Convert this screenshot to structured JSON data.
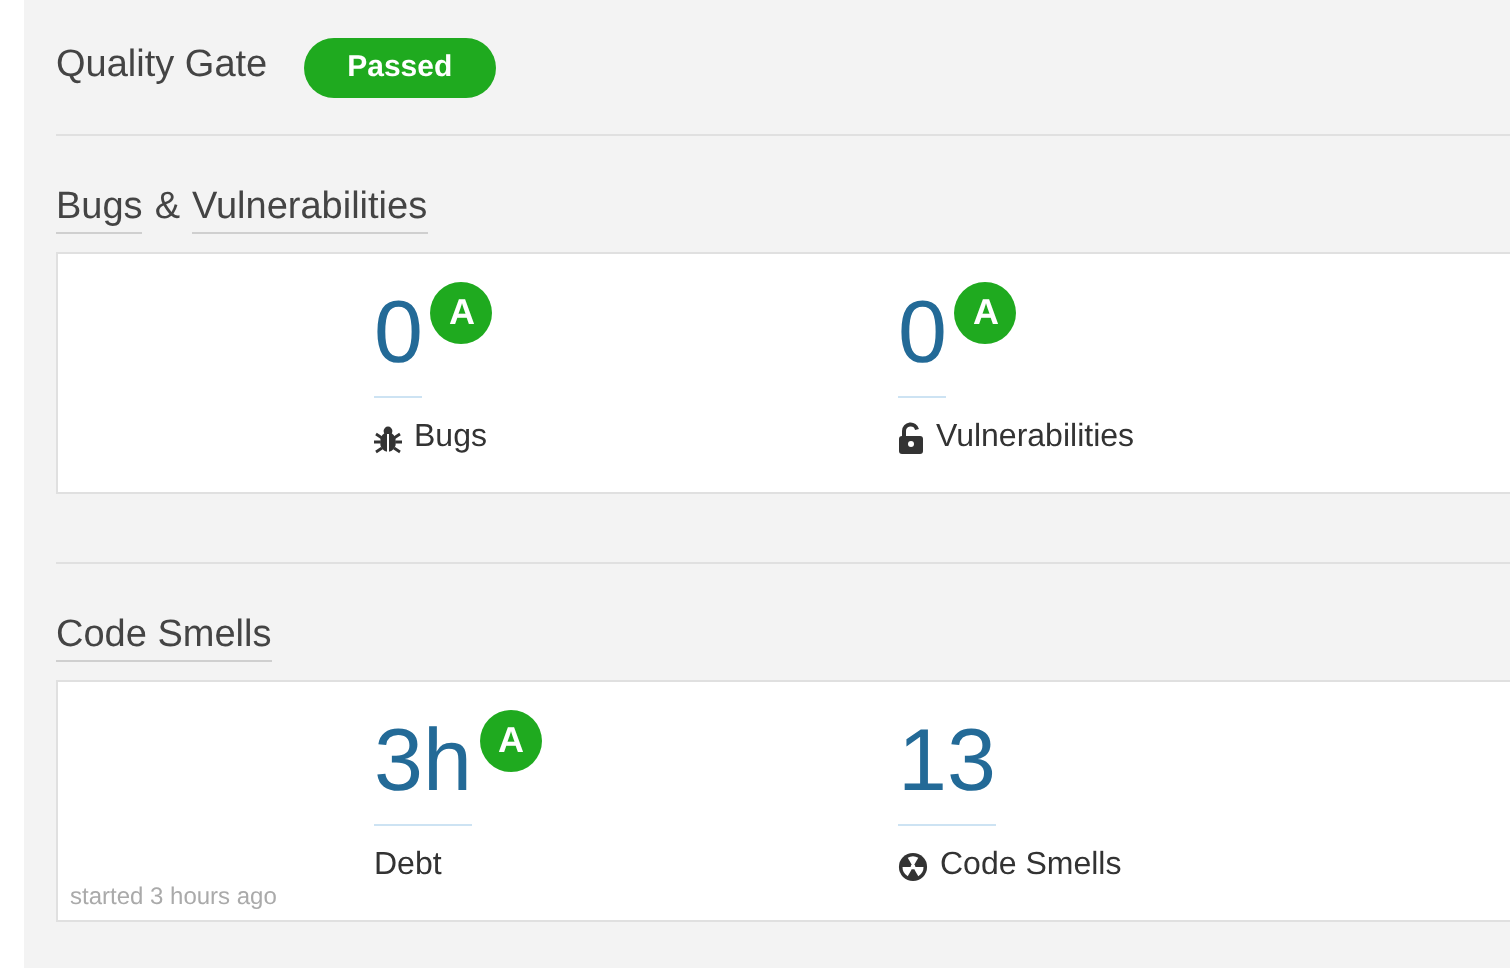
{
  "quality_gate": {
    "label": "Quality Gate",
    "status": "Passed",
    "passed": true
  },
  "sections": [
    {
      "title": [
        {
          "kind": "link",
          "text": "Bugs"
        },
        {
          "kind": "text",
          "text": "&"
        },
        {
          "kind": "link",
          "text": "Vulnerabilities"
        }
      ],
      "measures": [
        {
          "value": "0",
          "rating": "A",
          "label": "Bugs",
          "kind": "bug"
        },
        {
          "value": "0",
          "rating": "A",
          "label": "Vulnerabilities",
          "kind": "vulnerability"
        }
      ]
    },
    {
      "title": [
        {
          "kind": "link",
          "text": "Code Smells"
        }
      ],
      "measures": [
        {
          "value": "3h",
          "rating": "A",
          "label": "Debt",
          "kind": "debt"
        },
        {
          "value": "13",
          "label": "Code Smells",
          "kind": "smell"
        }
      ],
      "footer": "started 3 hours ago"
    }
  ]
}
